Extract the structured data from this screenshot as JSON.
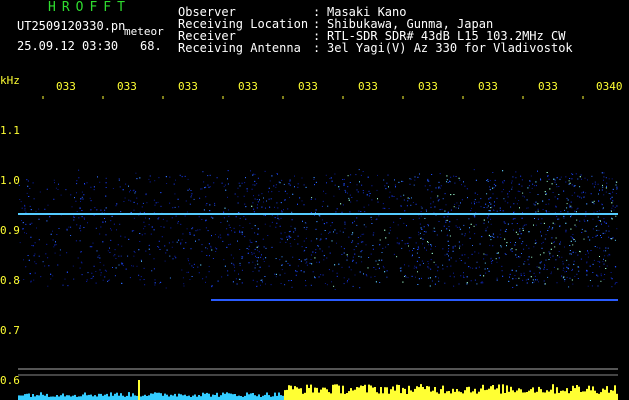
{
  "header": {
    "brand": "HROFFT",
    "filename": "UT2509120330.pn",
    "meteor_label": "meteor",
    "datetime": "25.09.12 03:30",
    "count": "68."
  },
  "meta": [
    {
      "label": "Observer",
      "value": "Masaki Kano"
    },
    {
      "label": "Receiving Location",
      "value": "Shibukawa, Gunma, Japan"
    },
    {
      "label": "Receiver",
      "value": "RTL-SDR SDR# 43dB L15 103.2MHz CW"
    },
    {
      "label": "Receiving Antenna",
      "value": "3el Yagi(V) Az 330 for Vladivostok"
    }
  ],
  "axis": {
    "unit": "kHz",
    "x_ticks": [
      "033",
      "033",
      "033",
      "033",
      "033",
      "033",
      "033",
      "033",
      "033",
      "0340"
    ],
    "y_ticks": [
      "1.1",
      "1.0",
      "0.9",
      "0.8",
      "0.7",
      "0.6"
    ]
  },
  "colors": {
    "text_green": "#2fdc2f",
    "text_yellow": "#ffff33",
    "background": "#000000",
    "signal_blue": "#1a3cff",
    "carrier_cyan": "#55ccff"
  }
}
